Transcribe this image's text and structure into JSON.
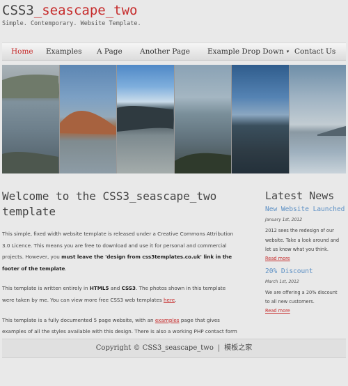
{
  "logo": {
    "title_prefix": "CSS3",
    "title_accent": "_seascape_two",
    "slogan": "Simple. Contemporary. Website Template."
  },
  "menu": {
    "items": [
      {
        "label": "Home",
        "selected": true
      },
      {
        "label": "Examples"
      },
      {
        "label": "A Page"
      },
      {
        "label": "Another Page"
      },
      {
        "label": "Example Drop Down",
        "dropdown": true
      },
      {
        "label": "Contact Us"
      }
    ],
    "dropdown_caret": "▾"
  },
  "banner": {
    "panels": [
      "cliffs-sea",
      "red-rock-shore",
      "rocky-tidepools",
      "grassy-shoreline",
      "calm-bay",
      "distant-headland"
    ]
  },
  "main": {
    "heading": "Welcome to the CSS3_seascape_two template",
    "p1": {
      "text": "This simple, fixed width website template is released under a Creative Commons Attribution 3.0 Licence. This means you are free to download and use it for personal and commercial projects. However, you ",
      "bold": "must leave the 'design from css3templates.co.uk' link in the footer of the template",
      "end": "."
    },
    "p2": {
      "a": "This template is written entirely in ",
      "b1": "HTML5",
      "and": " and ",
      "b2": "CSS3",
      "c": ". The photos shown in this template were taken by me. You can view more free CSS3 web templates ",
      "link": "here",
      "end": "."
    },
    "p3": {
      "a": "This template is a fully documented 5 page website, with an ",
      "link": "examples",
      "b": " page that gives examples of all the styles available with this design. There is also a working PHP contact form on the contact page. All of the seascapes were taken by me - use as you wish."
    }
  },
  "sidebar": {
    "heading": "Latest News",
    "news": [
      {
        "title": "New Website Launched",
        "date": "January 1st, 2012",
        "text": "2012 sees the redesign of our website. Take a look around and let us know what you think.",
        "link": "Read more"
      },
      {
        "title": "20% Discount",
        "date": "March 1st, 2012",
        "text": "We are offering a 20% discount to all new customers.",
        "link": "Read more"
      }
    ]
  },
  "footer": {
    "copyright": "Copyright © CSS3_seascape_two",
    "separator": "|",
    "link": "模板之家"
  },
  "colors": {
    "accent": "#c62c2c",
    "news_title": "#5b8fc4",
    "background": "#e9e9e9"
  }
}
